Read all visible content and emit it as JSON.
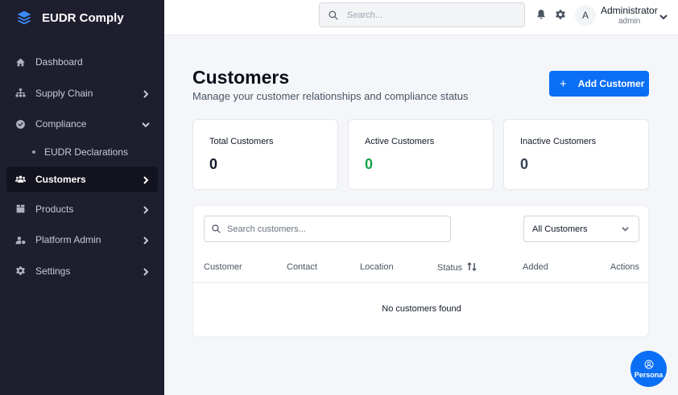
{
  "app": {
    "name": "EUDR Comply",
    "logo_icon": "layers-icon"
  },
  "sidebar": {
    "items": [
      {
        "label": "Dashboard",
        "icon": "home-icon"
      },
      {
        "label": "Supply Chain",
        "icon": "sitemap-icon"
      },
      {
        "label": "Compliance",
        "icon": "check-circle-icon"
      },
      {
        "label": "EUDR Declarations"
      },
      {
        "label": "Customers",
        "icon": "users-icon"
      },
      {
        "label": "Products",
        "icon": "box-icon"
      },
      {
        "label": "Platform Admin",
        "icon": "users-cog-icon"
      },
      {
        "label": "Settings",
        "icon": "gear-icon"
      }
    ]
  },
  "header": {
    "search_placeholder": "Search...",
    "user": {
      "initial": "A",
      "name": "Administrator",
      "role": "admin"
    }
  },
  "page": {
    "title": "Customers",
    "subtitle": "Manage your customer relationships and compliance status",
    "add_button": "Add Customer"
  },
  "stats": [
    {
      "label": "Total Customers",
      "value": "0",
      "color": "#111827"
    },
    {
      "label": "Active Customers",
      "value": "0",
      "color": "#16a34a"
    },
    {
      "label": "Inactive Customers",
      "value": "0",
      "color": "#374151"
    }
  ],
  "table": {
    "search_placeholder": "Search customers...",
    "filter_selected": "All Customers",
    "columns": [
      "Customer",
      "Contact",
      "Location",
      "Status",
      "Added",
      "Actions"
    ],
    "empty_text": "No customers found"
  },
  "persona": {
    "label": "Persona"
  },
  "colors": {
    "sidebar_bg": "#1e1e2f",
    "accent": "#0b6ff5",
    "success": "#16a34a"
  }
}
